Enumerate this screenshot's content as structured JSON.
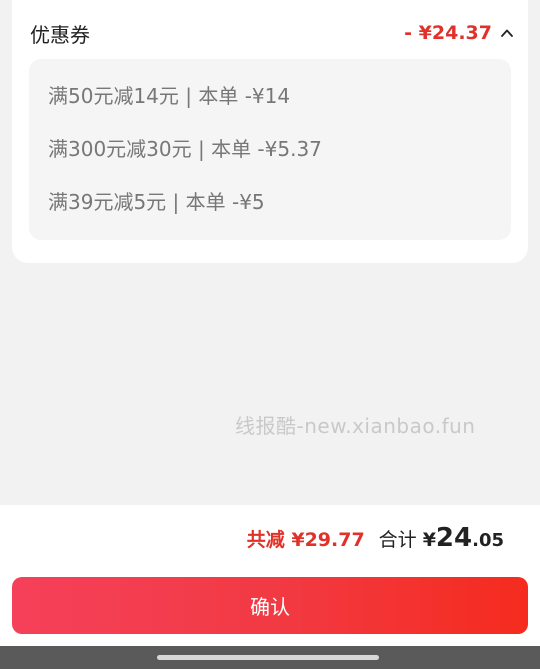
{
  "coupons": {
    "title": "优惠券",
    "total_discount": "- ¥24.37",
    "expand_icon": "chevron-up-icon",
    "items": [
      "满50元减14元 | 本单 -¥14",
      "满300元减30元 | 本单 -¥5.37",
      "满39元减5元 | 本单 -¥5"
    ]
  },
  "watermark": "线报酷-new.xianbao.fun",
  "summary": {
    "discount_text": "共减 ¥29.77",
    "total_label": "合计",
    "total_currency": "¥",
    "total_integer": "24",
    "total_decimal": ".05"
  },
  "confirm_label": "确认",
  "colors": {
    "accent": "#e0322a",
    "button_gradient_start": "#f5405a",
    "button_gradient_end": "#f52b1e"
  }
}
